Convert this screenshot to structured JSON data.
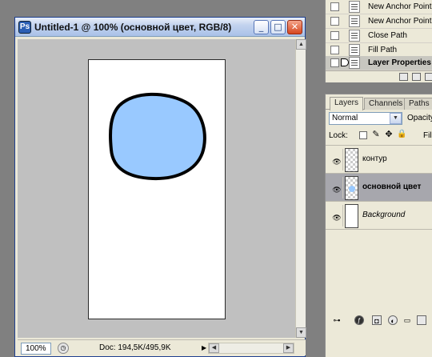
{
  "document": {
    "title": "Untitled-1 @ 100% (основной цвет, RGB/8)",
    "zoom": "100%",
    "doc_info": "Doc: 194,5K/495,9K",
    "shape_fill": "#99c9ff"
  },
  "history": {
    "items": [
      {
        "label": "New Anchor Point",
        "active": false
      },
      {
        "label": "New Anchor Point",
        "active": false
      },
      {
        "label": "Close Path",
        "active": false
      },
      {
        "label": "Fill Path",
        "active": false
      },
      {
        "label": "Layer Properties",
        "active": true
      }
    ]
  },
  "layers_panel": {
    "tabs": [
      "Layers",
      "Channels",
      "Paths"
    ],
    "active_tab": "Layers",
    "blend_mode": "Normal",
    "opacity_label": "Opacity",
    "lock_label": "Lock:",
    "fill_label": "Fill",
    "layers": [
      {
        "name": "контур",
        "selected": false,
        "visible": true,
        "thumb": "transparent"
      },
      {
        "name": "основной цвет",
        "selected": true,
        "visible": true,
        "thumb": "shape"
      },
      {
        "name": "Background",
        "selected": false,
        "visible": true,
        "thumb": "white"
      }
    ]
  }
}
